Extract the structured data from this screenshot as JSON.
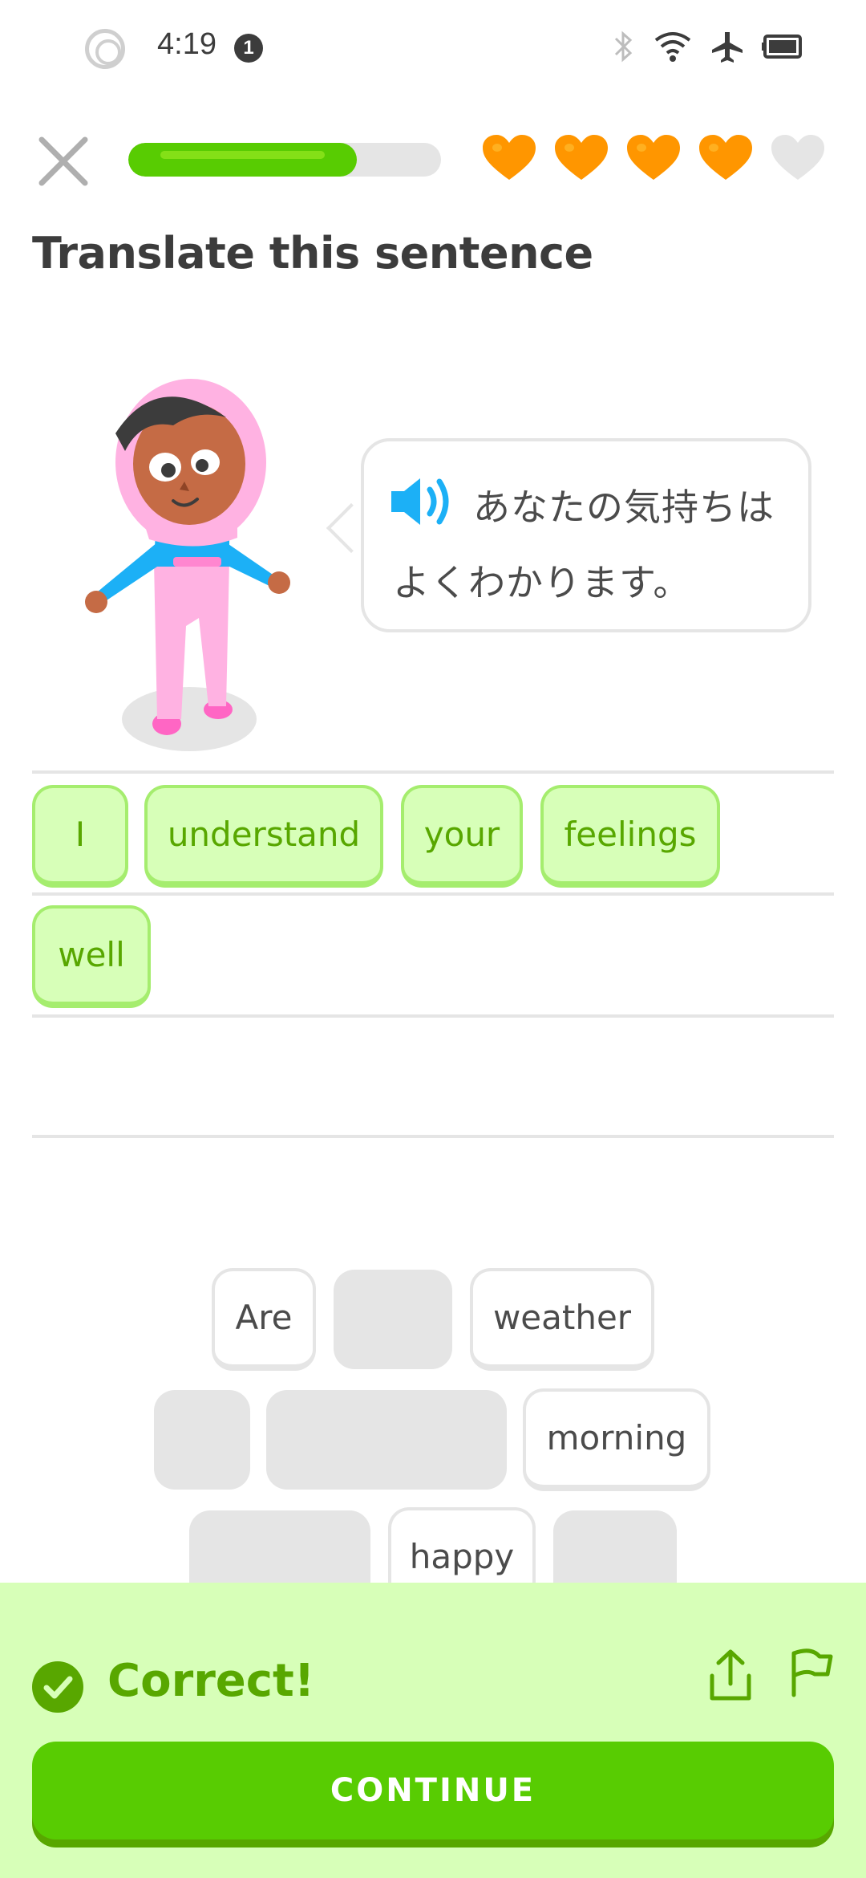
{
  "status_bar": {
    "time": "4:19",
    "notification_count": "1",
    "icons": [
      "radio-ring-icon",
      "bluetooth-icon",
      "wifi-icon",
      "airplane-mode-icon",
      "battery-icon"
    ]
  },
  "header": {
    "close_icon": "close-icon",
    "progress": 0.73,
    "hearts": [
      {
        "filled": true
      },
      {
        "filled": true
      },
      {
        "filled": true
      },
      {
        "filled": true
      },
      {
        "filled": false
      }
    ]
  },
  "title": "Translate this sentence",
  "prompt": {
    "speaker_icon": "speaker-icon",
    "line1": "あなたの気持ちは",
    "line2": "よくわかります。"
  },
  "answer_words": [
    "I",
    "understand",
    "your",
    "feelings",
    "well"
  ],
  "word_bank": {
    "visible_words": [
      "Are",
      "weather",
      "morning",
      "happy"
    ]
  },
  "feedback": {
    "status": "Correct!",
    "continue_label": "CONTINUE",
    "share_icon": "share-icon",
    "flag_icon": "flag-icon"
  },
  "colors": {
    "green": "#58cc02",
    "dark_green": "#58a700",
    "light_green": "#d7ffb8",
    "heart_orange": "#ff9600",
    "heart_empty": "#e5e5e5",
    "blue": "#1cb0f6"
  }
}
